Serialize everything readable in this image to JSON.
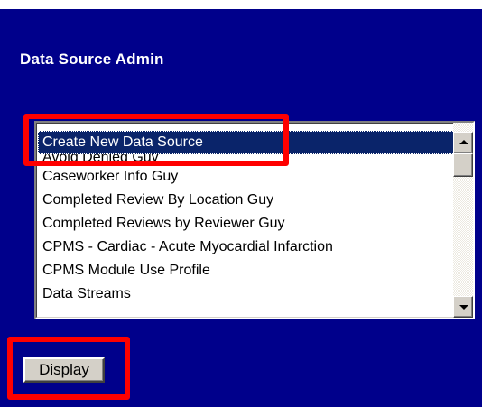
{
  "header": {
    "title": "Data Source Admin"
  },
  "data_source_list": {
    "selected_index": 0,
    "items": [
      "Create New Data Source",
      "Avoid Denied Guy",
      "Caseworker Info Guy",
      "Completed Review By Location Guy",
      "Completed Reviews by Reviewer Guy",
      "CPMS - Cardiac - Acute Myocardial Infarction",
      "CPMS Module Use Profile",
      "Data Streams"
    ]
  },
  "actions": {
    "display_label": "Display"
  },
  "colors": {
    "panel_background": "#00008b",
    "selection_background": "#0a246a",
    "annotation_highlight": "#ff0000"
  }
}
